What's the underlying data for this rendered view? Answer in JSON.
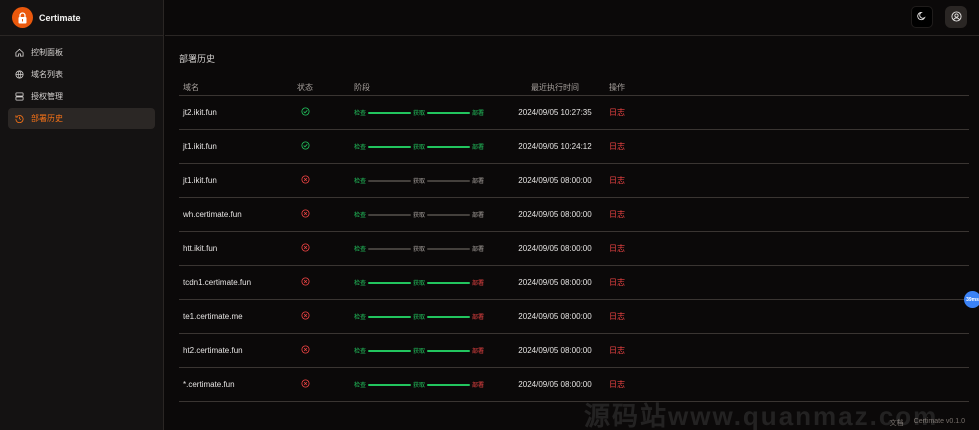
{
  "app": {
    "name": "Certimate",
    "version": "Certimate v0.1.0"
  },
  "sidebar": {
    "items": [
      {
        "label": "控制面板",
        "icon": "home-icon"
      },
      {
        "label": "域名列表",
        "icon": "globe-icon"
      },
      {
        "label": "授权管理",
        "icon": "server-icon"
      },
      {
        "label": "部署历史",
        "icon": "history-icon",
        "active": true
      }
    ]
  },
  "page": {
    "title": "部署历史"
  },
  "table": {
    "headers": {
      "domain": "域名",
      "status": "状态",
      "stage": "阶段",
      "time": "最近执行时间",
      "op": "操作"
    },
    "stage_labels": {
      "check": "检查",
      "obtain": "获取",
      "deploy": "部署"
    },
    "op_label": "日志",
    "rows": [
      {
        "domain": "jt2.ikit.fun",
        "status": "success",
        "stages": [
          "ok",
          "ok",
          "ok"
        ],
        "time": "2024/09/05 10:27:35"
      },
      {
        "domain": "jt1.ikit.fun",
        "status": "success",
        "stages": [
          "ok",
          "ok",
          "ok"
        ],
        "time": "2024/09/05 10:24:12"
      },
      {
        "domain": "jt1.ikit.fun",
        "status": "fail",
        "stages": [
          "ok",
          "pending",
          "pending"
        ],
        "time": "2024/09/05 08:00:00"
      },
      {
        "domain": "wh.certimate.fun",
        "status": "fail",
        "stages": [
          "ok",
          "pending",
          "pending"
        ],
        "time": "2024/09/05 08:00:00"
      },
      {
        "domain": "htt.ikit.fun",
        "status": "fail",
        "stages": [
          "ok",
          "pending",
          "pending"
        ],
        "time": "2024/09/05 08:00:00"
      },
      {
        "domain": "tcdn1.certimate.fun",
        "status": "fail",
        "stages": [
          "ok",
          "ok",
          "fail"
        ],
        "time": "2024/09/05 08:00:00"
      },
      {
        "domain": "te1.certimate.me",
        "status": "fail",
        "stages": [
          "ok",
          "ok",
          "fail"
        ],
        "time": "2024/09/05 08:00:00"
      },
      {
        "domain": "ht2.certimate.fun",
        "status": "fail",
        "stages": [
          "ok",
          "ok",
          "fail"
        ],
        "time": "2024/09/05 08:00:00"
      },
      {
        "domain": "*.certimate.fun",
        "status": "fail",
        "stages": [
          "ok",
          "ok",
          "fail"
        ],
        "time": "2024/09/05 08:00:00"
      }
    ]
  },
  "footer": {
    "docs": "文档"
  },
  "float_badge": "39ms",
  "watermark": "源码站www.quanmaz.com",
  "colors": {
    "accent": "#f97316",
    "success": "#22c55e",
    "error": "#ef4444"
  }
}
